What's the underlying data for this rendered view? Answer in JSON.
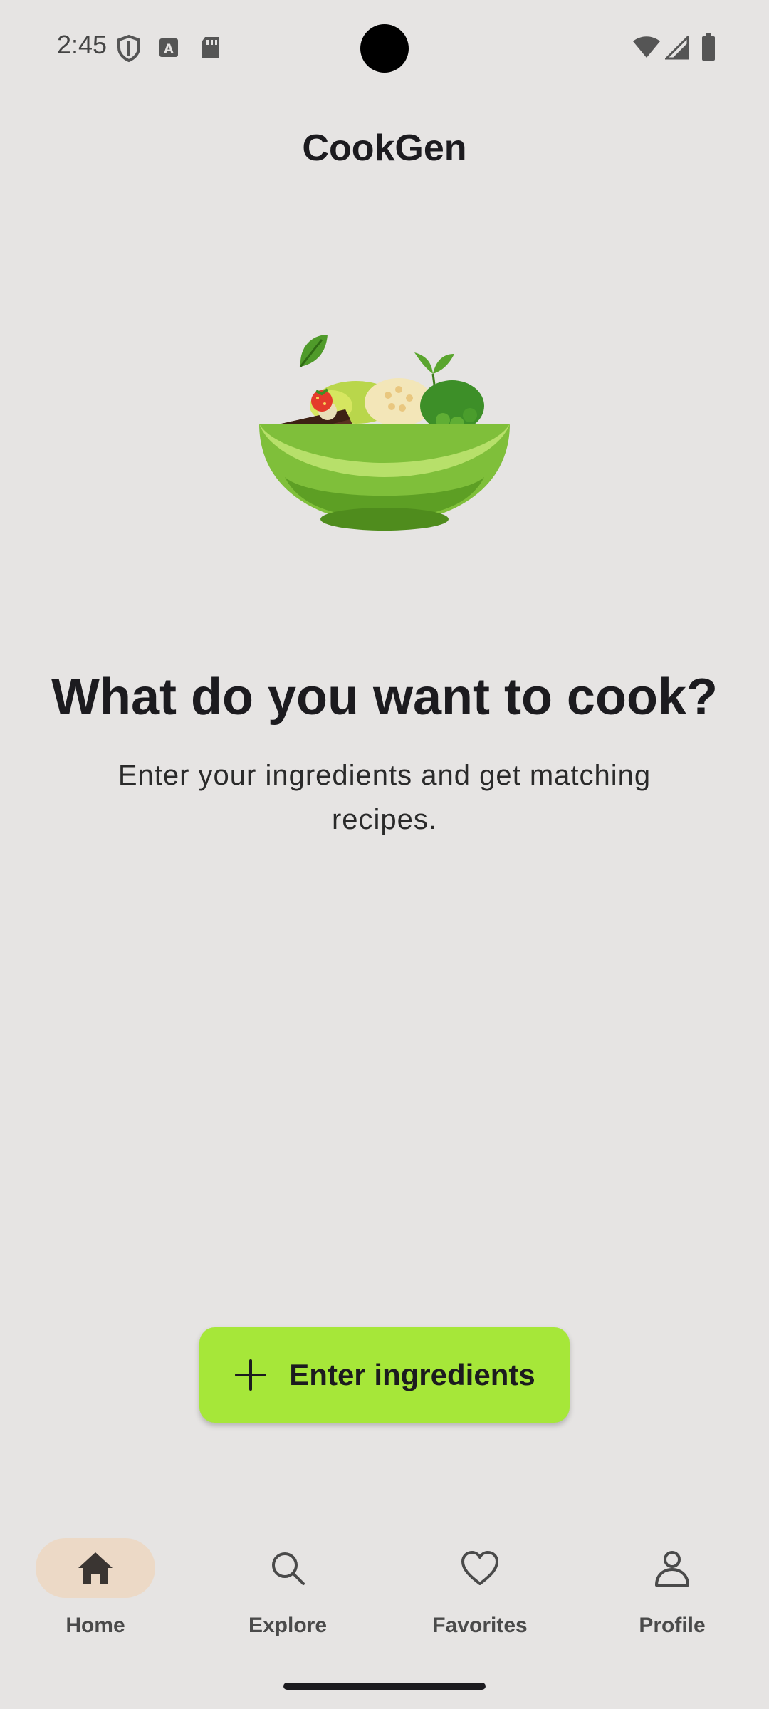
{
  "status_bar": {
    "time": "2:45",
    "left_icons": [
      "shield-icon",
      "keyboard-a-icon",
      "sd-card-icon"
    ],
    "right_icons": [
      "wifi-icon",
      "cellular-signal-icon",
      "battery-icon"
    ]
  },
  "app": {
    "title": "CookGen"
  },
  "hero": {
    "image": "salad-bowl-illustration",
    "headline": "What do you want to cook?",
    "subtext": "Enter your ingredients and get matching recipes."
  },
  "cta": {
    "icon": "plus-icon",
    "label": "Enter ingredients",
    "color": "#a6e739"
  },
  "bottom_nav": {
    "active": "Home",
    "active_pill_color": "#ecd9c6",
    "items": [
      {
        "label": "Home",
        "icon": "home-icon"
      },
      {
        "label": "Explore",
        "icon": "search-icon"
      },
      {
        "label": "Favorites",
        "icon": "heart-icon"
      },
      {
        "label": "Profile",
        "icon": "person-icon"
      }
    ]
  }
}
